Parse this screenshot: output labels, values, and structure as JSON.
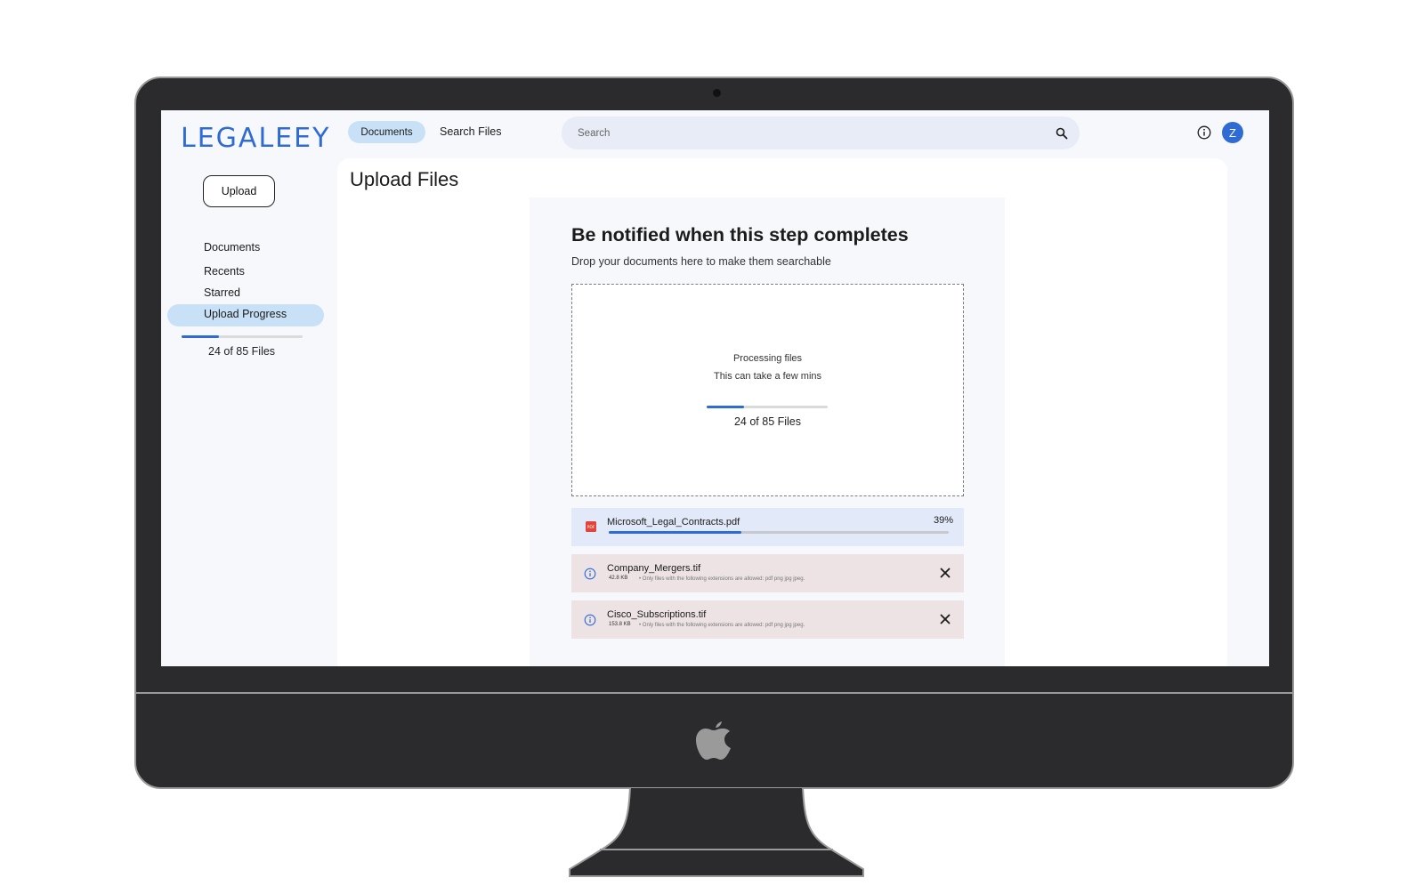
{
  "app": {
    "logo_text": "LEGALEEY"
  },
  "sidebar": {
    "upload_label": "Upload",
    "items": [
      {
        "label": "Documents"
      },
      {
        "label": "Recents"
      },
      {
        "label": "Starred"
      },
      {
        "label": "Upload Progress",
        "active": true
      }
    ],
    "progress": {
      "fraction": 0.31,
      "text": "24 of 85 Files"
    }
  },
  "header": {
    "tabs": [
      {
        "label": "Documents",
        "active": true
      },
      {
        "label": "Search Files",
        "active": false
      }
    ],
    "search": {
      "placeholder": "Search",
      "value": ""
    },
    "avatar_initial": "Z",
    "icons": {
      "search": "search-icon",
      "info": "info-icon"
    }
  },
  "main": {
    "title": "Upload Files",
    "card": {
      "heading": "Be notified when this step completes",
      "subtitle": "Drop your documents here to make them searchable",
      "dropzone": {
        "status": "Processing files",
        "note": "This can take a few mins",
        "progress_fraction": 0.31,
        "count_text": "24 of 85 Files"
      },
      "files": [
        {
          "name": "Microsoft_Legal_Contracts.pdf",
          "status": "uploading",
          "percent_text": "39%",
          "progress_fraction": 0.39,
          "icon": "pdf-icon"
        },
        {
          "name": "Company_Mergers.tif",
          "status": "error",
          "size": "42.8 KB",
          "note": "Only files with the following extensions are allowed: pdf png jpg jpeg.",
          "icon": "info-icon"
        },
        {
          "name": "Cisco_Subscriptions.tif",
          "status": "error",
          "size": "153.8 KB",
          "note": "Only files with the following extensions are allowed: pdf png jpg jpeg.",
          "icon": "info-icon"
        }
      ]
    }
  },
  "colors": {
    "brand": "#2f6bd4",
    "active_pill": "#c9e1f7",
    "error_row": "#ede3e4",
    "upload_row": "#e2e9f9",
    "bezel": "#2b2b2d"
  }
}
